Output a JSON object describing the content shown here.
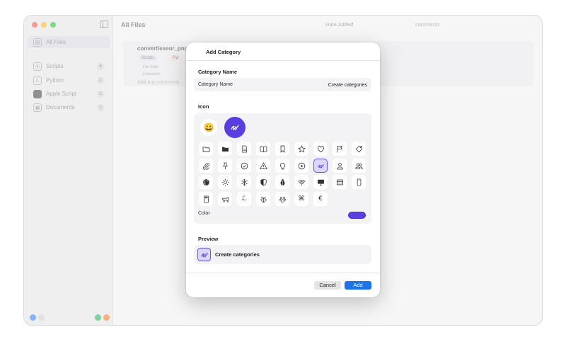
{
  "app": {
    "title": "All Files",
    "sort_label": "Date Added",
    "search_value": "comments"
  },
  "sidebar": {
    "items": [
      {
        "label": "All Files",
        "count": ""
      },
      {
        "label": "Scripts",
        "count": "4"
      },
      {
        "label": "Python",
        "count": "2"
      },
      {
        "label": "Apple Script",
        "count": "1"
      },
      {
        "label": "Documents",
        "count": "1"
      }
    ]
  },
  "file_row": {
    "name": "convertisseur_png",
    "tag1": "Scripts",
    "tag2": "Pyt",
    "file_path_label": "File Path",
    "comment_label": "Comment",
    "comment_placeholder": "Add any comments"
  },
  "modal": {
    "title": "Add Category",
    "category_name_section": "Category Name",
    "category_name_label": "Category Name",
    "category_name_value": "Create categories",
    "icon_section": "Icon",
    "current_emoji": "😀",
    "color_label": "Color",
    "accent_color": "#5a3ee0",
    "preview_section": "Preview",
    "preview_text": "Create categories",
    "cancel_label": "Cancel",
    "add_label": "Add"
  },
  "icons": [
    [
      "folder-icon",
      "folder-fill-icon",
      "document-icon",
      "book-icon",
      "bookmark-icon",
      "star-icon",
      "heart-icon",
      "flag-icon",
      "tag-icon"
    ],
    [
      "paperclip-icon",
      "pin-icon",
      "checkmark-circle-icon",
      "warning-icon",
      "lightbulb-icon",
      "play-circle-icon",
      "scribble-icon",
      "person-icon",
      "people-icon"
    ],
    [
      "globe-icon",
      "sun-icon",
      "snowflake-icon",
      "shield-icon",
      "ladybug-icon",
      "wifi-icon",
      "display-icon",
      "server-icon",
      "laptop-icon",
      "phone-icon"
    ],
    [
      "calculator-icon",
      "dog-icon",
      "python-icon",
      "bug-icon",
      "paw-icon",
      "command-icon",
      "euro-icon"
    ]
  ],
  "selected_icon": "scribble-icon"
}
